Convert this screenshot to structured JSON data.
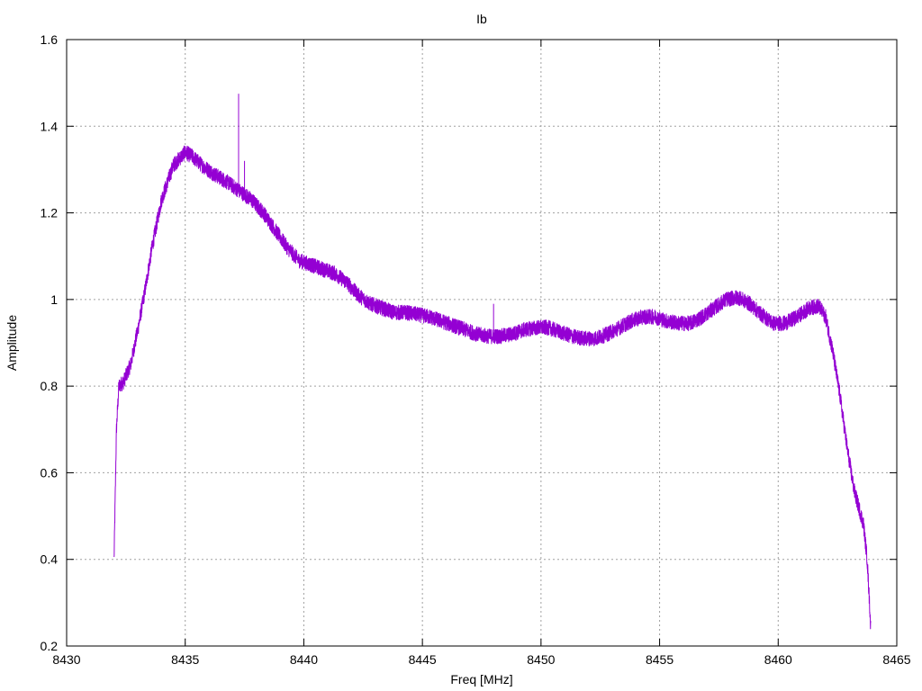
{
  "chart_data": {
    "type": "line",
    "title": "Ib",
    "xlabel": "Freq [MHz]",
    "ylabel": "Amplitude",
    "xlim": [
      8430,
      8465
    ],
    "ylim": [
      0.2,
      1.6
    ],
    "xticks": [
      8430,
      8435,
      8440,
      8445,
      8450,
      8455,
      8460,
      8465
    ],
    "yticks": [
      0.2,
      0.4,
      0.6,
      0.8,
      1.0,
      1.2,
      1.4,
      1.6
    ],
    "ytick_labels": [
      "0.2",
      "0.4",
      "0.6",
      "0.8",
      "1",
      "1.2",
      "1.4",
      "1.6"
    ],
    "grid": true,
    "legend": "none",
    "series": [
      {
        "color": "#9400d3",
        "x": [
          8432.0,
          8432.1,
          8432.2,
          8432.4,
          8432.7,
          8433.0,
          8433.3,
          8433.6,
          8434.0,
          8434.5,
          8435.0,
          8435.3,
          8435.7,
          8436.2,
          8436.8,
          8437.3,
          8437.8,
          8438.3,
          8438.8,
          8439.3,
          8439.8,
          8440.3,
          8440.8,
          8441.3,
          8441.8,
          8442.3,
          8442.8,
          8443.3,
          8443.8,
          8444.3,
          8444.8,
          8445.3,
          8445.8,
          8446.3,
          8446.8,
          8447.3,
          8447.8,
          8448.3,
          8448.8,
          8449.3,
          8449.8,
          8450.3,
          8450.8,
          8451.3,
          8451.8,
          8452.3,
          8452.8,
          8453.3,
          8453.8,
          8454.3,
          8454.8,
          8455.3,
          8455.8,
          8456.3,
          8456.8,
          8457.3,
          8457.8,
          8458.3,
          8458.8,
          8459.3,
          8459.8,
          8460.3,
          8460.8,
          8461.3,
          8461.7,
          8462.0,
          8462.3,
          8462.6,
          8462.9,
          8463.2,
          8463.4,
          8463.6,
          8463.75,
          8463.85,
          8463.9
        ],
        "y": [
          0.4,
          0.7,
          0.8,
          0.81,
          0.85,
          0.93,
          1.02,
          1.12,
          1.23,
          1.31,
          1.34,
          1.33,
          1.31,
          1.29,
          1.27,
          1.25,
          1.23,
          1.2,
          1.16,
          1.12,
          1.09,
          1.08,
          1.07,
          1.06,
          1.04,
          1.01,
          0.99,
          0.98,
          0.97,
          0.97,
          0.965,
          0.96,
          0.95,
          0.94,
          0.93,
          0.92,
          0.915,
          0.915,
          0.92,
          0.93,
          0.935,
          0.935,
          0.925,
          0.915,
          0.91,
          0.91,
          0.92,
          0.935,
          0.95,
          0.96,
          0.96,
          0.95,
          0.945,
          0.945,
          0.96,
          0.98,
          1.0,
          1.005,
          0.99,
          0.965,
          0.945,
          0.945,
          0.96,
          0.98,
          0.985,
          0.96,
          0.88,
          0.78,
          0.66,
          0.56,
          0.52,
          0.48,
          0.4,
          0.3,
          0.24
        ]
      }
    ],
    "spikes": [
      {
        "x": 8437.25,
        "y": 1.475
      },
      {
        "x": 8437.5,
        "y": 1.32
      },
      {
        "x": 8448.0,
        "y": 0.99
      }
    ]
  }
}
